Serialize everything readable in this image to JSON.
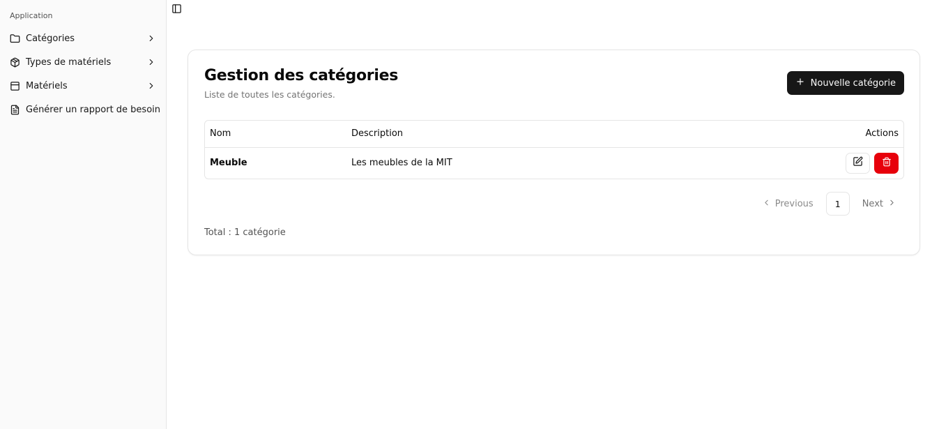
{
  "sidebar": {
    "group_label": "Application",
    "items": [
      {
        "label": "Catégories",
        "icon": "folder-icon",
        "has_chevron": true
      },
      {
        "label": "Types de matériels",
        "icon": "package-icon",
        "has_chevron": true
      },
      {
        "label": "Matériels",
        "icon": "panel-icon",
        "has_chevron": true
      },
      {
        "label": "Générer un rapport de besoin",
        "icon": "file-text-icon",
        "has_chevron": false
      }
    ]
  },
  "header": {
    "toggle_icon": "sidebar-toggle-icon"
  },
  "main": {
    "title": "Gestion des catégories",
    "subtitle": "Liste de toutes les catégories.",
    "new_button_label": "Nouvelle catégorie",
    "table": {
      "columns": [
        "Nom",
        "Description",
        "Actions"
      ],
      "rows": [
        {
          "nom": "Meuble",
          "description": "Les meubles de la MIT"
        }
      ]
    },
    "pagination": {
      "previous": "Previous",
      "current": "1",
      "next": "Next"
    },
    "total": "Total : 1 catégorie"
  },
  "colors": {
    "primary": "#171717",
    "danger": "#e7000b",
    "border": "#e5e5e5"
  }
}
